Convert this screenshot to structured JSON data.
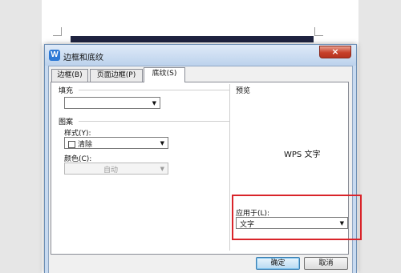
{
  "dialog": {
    "title": "边框和底纹",
    "app_icon_letter": "W",
    "close_glyph": "×"
  },
  "tabs": [
    {
      "label": "边框(B)",
      "active": false
    },
    {
      "label": "页面边框(P)",
      "active": false
    },
    {
      "label": "底纹(S)",
      "active": true
    }
  ],
  "fill": {
    "label": "填充",
    "value": ""
  },
  "pattern": {
    "label": "图案",
    "style_label": "样式(Y):",
    "style_value": "清除",
    "color_label": "颜色(C):",
    "color_value": "自动"
  },
  "preview": {
    "label": "预览",
    "sample_text": "WPS 文字"
  },
  "apply_to": {
    "label": "应用于(L):",
    "value": "文字"
  },
  "buttons": {
    "ok": "确定",
    "cancel": "取消"
  },
  "colors": {
    "highlight": "#d9242a",
    "title_bar": "#c8daf0",
    "close_button": "#c7402a",
    "document_bar": "#1f2340"
  }
}
